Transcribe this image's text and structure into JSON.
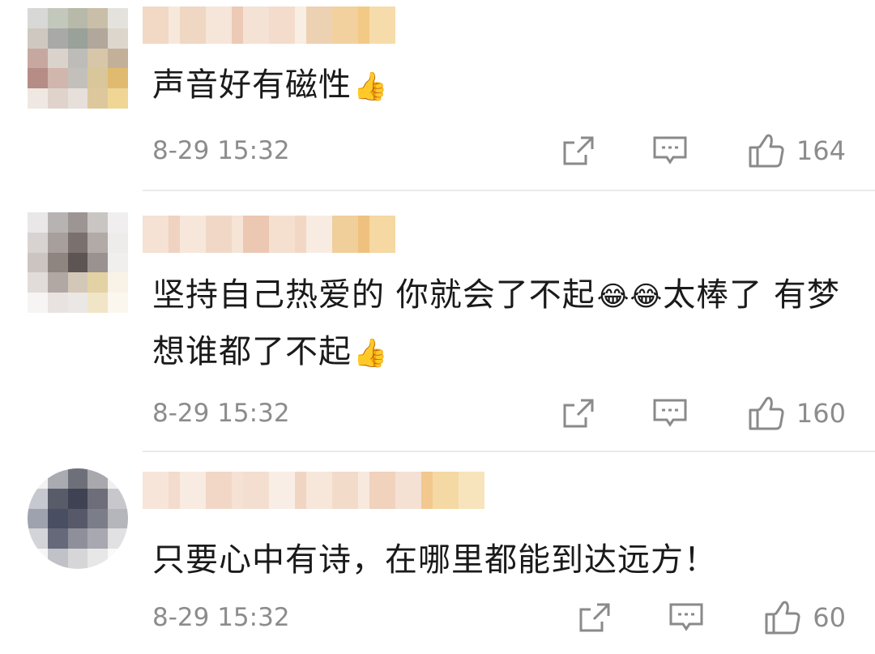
{
  "comments": [
    {
      "text": "声音好有磁性",
      "emoji": "👍",
      "time": "8-29 15:32",
      "likes": "164",
      "avatar_colors": [
        "#d8d8d6",
        "#c3c8bc",
        "#b7b9a9",
        "#c9bea8",
        "#e4e2dc",
        "#cfc8c0",
        "#a9a9a8",
        "#9aa09a",
        "#b1a79b",
        "#ddd6cc",
        "#c7a8a0",
        "#d9d3cb",
        "#bebcb8",
        "#d7c6a8",
        "#c2b098",
        "#b68c86",
        "#d0b6ac",
        "#c3c0bc",
        "#d9c79b",
        "#e0bb6f",
        "#efe8e2",
        "#dfd3cb",
        "#e7dfd9",
        "#ddc89e",
        "#efd694"
      ],
      "name_colors": [
        "#f1d9c6",
        "#f7e8dc",
        "#f0d7c3",
        "#f6e5d9",
        "#eccab5",
        "#f4e2d4",
        "#f3dccb",
        "#f9eee4",
        "#edd1b3",
        "#f2d19e",
        "#f3c986",
        "#f6dcaa"
      ]
    },
    {
      "text": "坚持自己热爱的 你就会了不起",
      "emoji": "😂😂",
      "text_after": "太棒了 有梦想谁都了不起",
      "emoji2": "👍",
      "time": "8-29 15:32",
      "likes": "160",
      "avatar_colors": [
        "#e9e7e7",
        "#b8b3b3",
        "#9d9593",
        "#c9c5c2",
        "#f0eeee",
        "#d8d3d1",
        "#a79f9c",
        "#7a716f",
        "#b1aaa6",
        "#eeeceb",
        "#cbc4c0",
        "#8e8480",
        "#5d5553",
        "#9a9290",
        "#f1eeee",
        "#e1dcd9",
        "#b1a8a3",
        "#d3c8b7",
        "#e3d2a4",
        "#f8f3e6",
        "#f7f5f3",
        "#e8e3e1",
        "#ebe7e4",
        "#f0e5c6",
        "#fbf7ef"
      ],
      "name_colors": [
        "#f5e2d4",
        "#efd2bf",
        "#f7e7db",
        "#f1d8c6",
        "#f6e4d6",
        "#ecc7b2",
        "#f5e0d0",
        "#f2d8c4",
        "#f8ece2",
        "#f0cf9b",
        "#efc17e",
        "#f5d8a2"
      ]
    },
    {
      "text": "只要心中有诗，在哪里都能到达远方！",
      "time": "8-29 15:32",
      "likes": "60",
      "avatar_colors": [
        "#f3f2f2",
        "#a9abb1",
        "#6e7079",
        "#a8a8ad",
        "#f0f0f0",
        "#c6c8cf",
        "#585b68",
        "#3f4253",
        "#6d6e7a",
        "#c8c8cc",
        "#9ea2ae",
        "#4a4e62",
        "#57596b",
        "#7b7d88",
        "#b5b6bb",
        "#d3d4d8",
        "#66697a",
        "#8e8f9a",
        "#a7a8b0",
        "#e1e1e3",
        "#f6f6f6",
        "#c1c2c8",
        "#d6d6d9",
        "#e7e7e8",
        "#fafafa"
      ],
      "name_colors": [
        "#f7e5d9",
        "#f3dccd",
        "#f8ebe1",
        "#f2d7c6",
        "#f6e2d4",
        "#f4decf",
        "#f9eee6",
        "#f1d5c3",
        "#f7e6da",
        "#f3dbca",
        "#f8e9df",
        "#f0d2bd",
        "#f5e1d3",
        "#f2c88f",
        "#f4d9a4",
        "#f7e4bd"
      ]
    }
  ]
}
